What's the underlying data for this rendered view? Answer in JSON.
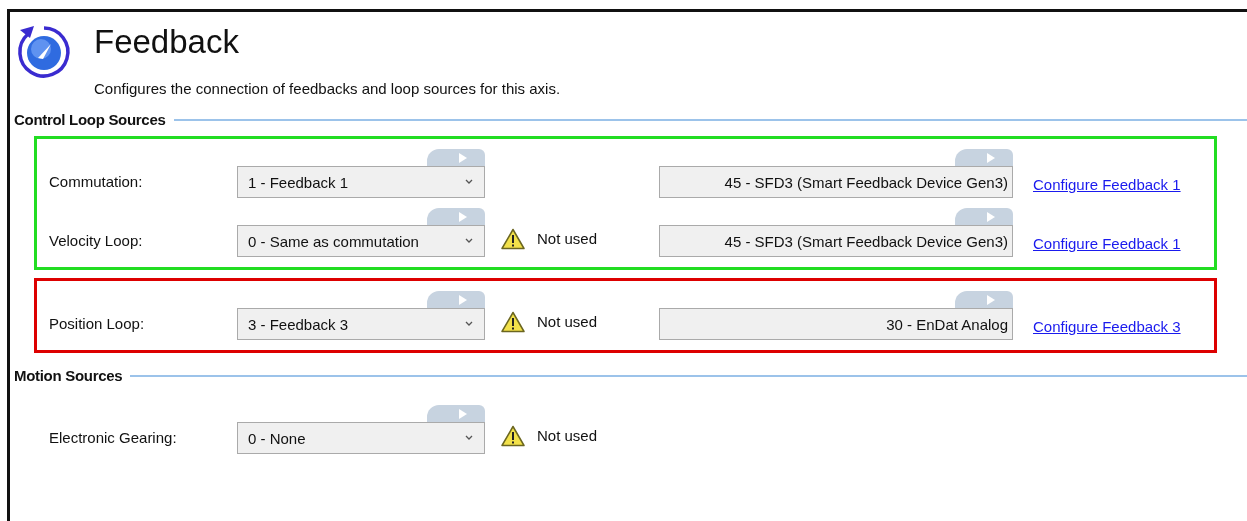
{
  "header": {
    "title": "Feedback",
    "description": "Configures the connection of feedbacks and loop sources for this axis."
  },
  "sections": [
    {
      "title": "Control Loop Sources",
      "groups": [
        {
          "color": "#22dd22",
          "rows": [
            {
              "label": "Commutation:",
              "selection": "1 - Feedback 1",
              "feedback_type": "45 - SFD3 (Smart Feedback Device Gen3)",
              "link": "Configure Feedback 1"
            },
            {
              "label": "Velocity Loop:",
              "selection": "0 - Same as commutation",
              "warning": "Not used",
              "feedback_type": "45 - SFD3 (Smart Feedback Device Gen3)",
              "link": "Configure Feedback 1"
            }
          ]
        },
        {
          "color": "#dd0000",
          "rows": [
            {
              "label": "Position Loop:",
              "selection": "3 - Feedback 3",
              "warning": "Not used",
              "feedback_type": "30 - EnDat Analog",
              "link": "Configure Feedback 3"
            }
          ]
        }
      ]
    },
    {
      "title": "Motion Sources",
      "groups": [
        {
          "rows": [
            {
              "label": "Electronic Gearing:",
              "selection": "0 - None",
              "warning": "Not used"
            }
          ]
        }
      ]
    }
  ]
}
